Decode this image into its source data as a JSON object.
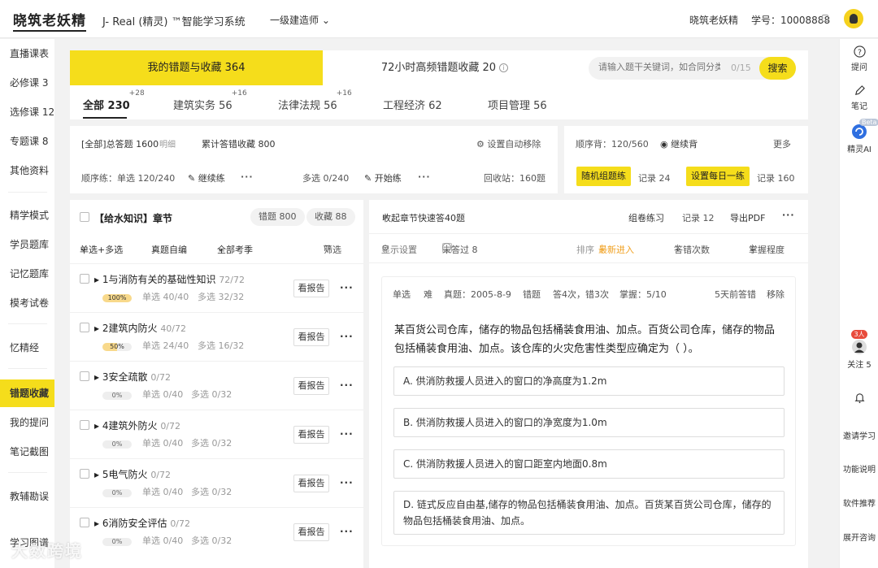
{
  "header": {
    "logo": "晓筑老妖精",
    "system_name": "J- Real (精灵) ™智能学习系统",
    "level_select": "一级建造师",
    "username": "晓筑老妖精",
    "student_id": "学号：10008888"
  },
  "left_nav": [
    "直播课表",
    "必修课 3",
    "选修课 12",
    "专题课 8",
    "其他资料",
    "精学模式",
    "学员题库",
    "记忆题库",
    "模考试卷",
    "忆精经",
    "错题收藏",
    "我的提问",
    "笔记截图",
    "教辅勘误",
    "学习图谱"
  ],
  "right_nav": {
    "ask": "提问",
    "notes": "笔记",
    "ai_badge": "Beta",
    "ai": "精灵AI",
    "follow_badge": "3人",
    "follow": "关注 5",
    "invite": "邀请学习",
    "feature": "功能说明",
    "software": "软件推荐",
    "consult": "展开咨询"
  },
  "top_tabs": {
    "mine": "我的错题与收藏  364",
    "hot72": "72小时高频错题收藏  20",
    "search_placeholder": "请输入题干关键词，如合同分类",
    "search_count": "0/15",
    "search_button": "搜索"
  },
  "sub_tabs": [
    {
      "label": "全部  230",
      "badge": "+28"
    },
    {
      "label": "建筑实务  56",
      "badge": "+16"
    },
    {
      "label": "法律法规  56",
      "badge": "+16"
    },
    {
      "label": "工程经济  62",
      "badge": ""
    },
    {
      "label": "项目管理  56",
      "badge": ""
    }
  ],
  "stats": {
    "total": "[全部]总答题 1600",
    "detail": "明细",
    "wrong_total": "累计答错收藏 800",
    "auto_remove": "设置自动移除",
    "order_single": "顺序练：单选 120/240",
    "continue": "继续练",
    "multi": "多选 0/240",
    "start": "开始练",
    "recycle": "回收站：160题"
  },
  "side_card": {
    "order_recite": "顺序背：120/560",
    "continue_recite": "继续背",
    "more": "更多",
    "random_btn": "随机组题练",
    "record1": "记录 24",
    "daily_btn": "设置每日一练",
    "record2": "记录 160"
  },
  "chapter": {
    "title": "【给水知识】章节",
    "wrong_pill": "错题 800",
    "fav_pill": "收藏 88",
    "filter_type": "单选+多选",
    "filter_source": "真题自编",
    "filter_season": "全部考季",
    "filter_btn": "筛选",
    "report_label": "看报告",
    "rows": [
      {
        "title": "1与消防有关的基础性知识",
        "count": "72/72",
        "pct": "100%",
        "single": "单选 40/40",
        "multi": "多选 32/32"
      },
      {
        "title": "2建筑内防火",
        "count": "40/72",
        "pct": "50%",
        "single": "单选 24/40",
        "multi": "多选 16/32"
      },
      {
        "title": "3安全疏散",
        "count": "0/72",
        "pct": "0%",
        "single": "单选 0/40",
        "multi": "多选 0/32"
      },
      {
        "title": "4建筑外防火",
        "count": "0/72",
        "pct": "0%",
        "single": "单选 0/40",
        "multi": "多选 0/32"
      },
      {
        "title": "5电气防火",
        "count": "0/72",
        "pct": "0%",
        "single": "单选 0/40",
        "multi": "多选 0/32"
      },
      {
        "title": "6消防安全评估",
        "count": "0/72",
        "pct": "0%",
        "single": "单选 0/40",
        "multi": "多选 0/32"
      }
    ]
  },
  "question_panel": {
    "collapse": "收起章节快速答40题",
    "compose": "组卷练习",
    "record": "记录 12",
    "export": "导出PDF",
    "display_settings": "显示设置",
    "unanswered": "未答过 8",
    "sort_label": "排序",
    "sort_latest": "最新进入",
    "sort_wrong": "答错次数",
    "sort_mastery": "掌握程度",
    "meta": {
      "type": "单选",
      "difficulty": "难",
      "source": "真题：2005-8-9",
      "kind": "错题",
      "answers": "答4次，错3次",
      "mastery": "掌握：5/10",
      "time": "5天前答错",
      "remove": "移除"
    },
    "question": "某百货公司仓库，储存的物品包括桶装食用油、加点。百货公司仓库，储存的物品包括桶装食用油、加点。该仓库的火灾危害性类型应确定为（   ）。",
    "options": [
      "A. 供消防救援人员进入的窗口的净高度为1.2m",
      "B. 供消防救援人员进入的窗口的净宽度为1.0m",
      "C. 供消防救援人员进入的窗口距室内地面0.8m",
      "D. 链式反应自由基,储存的物品包括桶装食用油、加点。百货某百货公司仓库，储存的物品包括桶装食用油、加点。"
    ]
  },
  "watermark": "大数跨境",
  "colors": {
    "accent": "#f5dd1b",
    "orange": "#f0a020"
  }
}
